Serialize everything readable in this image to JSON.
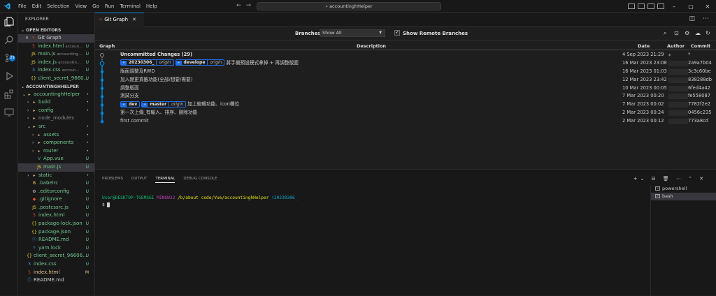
{
  "menu": [
    "File",
    "Edit",
    "Selection",
    "View",
    "Go",
    "Run",
    "Terminal",
    "Help"
  ],
  "search": {
    "text": "accountinghHelper"
  },
  "explorer": {
    "title": "EXPLORER",
    "open_editors": "OPEN EDITORS",
    "open_items": [
      {
        "name": "Git Graph",
        "sub": "",
        "status": "",
        "icon": "git-graph-icon",
        "color": "#cccccc"
      },
      {
        "name": "index.html",
        "sub": "accoun...",
        "status": "U",
        "icon": "html-icon",
        "color": "#73c991"
      },
      {
        "name": "main.js",
        "sub": "accounting...",
        "status": "U",
        "icon": "js-icon",
        "color": "#73c991"
      },
      {
        "name": "index.js",
        "sub": "accountin...",
        "status": "U",
        "icon": "js-icon",
        "color": "#73c991"
      },
      {
        "name": "index.css",
        "sub": "accoun...",
        "status": "U",
        "icon": "css-icon",
        "color": "#73c991"
      },
      {
        "name": "client_secret_9660...",
        "sub": "",
        "status": "U",
        "icon": "json-icon",
        "color": "#73c991"
      }
    ],
    "project": "ACCOUNTINGHHELPER",
    "tree": [
      {
        "name": "accountinghHelper",
        "indent": 0,
        "chev": "⌄",
        "status": "•",
        "icon": "folder-icon",
        "color": "#73c991"
      },
      {
        "name": "build",
        "indent": 1,
        "chev": "›",
        "status": "•",
        "icon": "folder-icon",
        "color": "#73c991"
      },
      {
        "name": "config",
        "indent": 1,
        "chev": "›",
        "status": "•",
        "icon": "folder-icon",
        "color": "#73c991"
      },
      {
        "name": "node_modules",
        "indent": 1,
        "chev": "›",
        "status": "",
        "icon": "folder-icon",
        "color": "#8c8c8c"
      },
      {
        "name": "src",
        "indent": 1,
        "chev": "⌄",
        "status": "•",
        "icon": "folder-icon",
        "color": "#73c991"
      },
      {
        "name": "assets",
        "indent": 2,
        "chev": "›",
        "status": "•",
        "icon": "folder-icon",
        "color": "#73c991"
      },
      {
        "name": "components",
        "indent": 2,
        "chev": "›",
        "status": "•",
        "icon": "folder-icon",
        "color": "#73c991"
      },
      {
        "name": "router",
        "indent": 2,
        "chev": "›",
        "status": "•",
        "icon": "folder-icon",
        "color": "#73c991"
      },
      {
        "name": "App.vue",
        "indent": 2,
        "chev": "",
        "status": "U",
        "icon": "vue-icon",
        "color": "#73c991"
      },
      {
        "name": "main.js",
        "indent": 2,
        "chev": "",
        "status": "U",
        "icon": "js-icon",
        "color": "#73c991",
        "selected": true
      },
      {
        "name": "static",
        "indent": 1,
        "chev": "›",
        "status": "•",
        "icon": "folder-icon",
        "color": "#73c991"
      },
      {
        "name": ".babelrc",
        "indent": 1,
        "chev": "",
        "status": "U",
        "icon": "babel-icon",
        "color": "#73c991"
      },
      {
        "name": ".editorconfig",
        "indent": 1,
        "chev": "",
        "status": "U",
        "icon": "gear-icon",
        "color": "#73c991"
      },
      {
        "name": ".gitignore",
        "indent": 1,
        "chev": "",
        "status": "U",
        "icon": "git-icon",
        "color": "#73c991"
      },
      {
        "name": ".postcssrc.js",
        "indent": 1,
        "chev": "",
        "status": "U",
        "icon": "js-icon",
        "color": "#73c991"
      },
      {
        "name": "index.html",
        "indent": 1,
        "chev": "",
        "status": "U",
        "icon": "html-icon",
        "color": "#73c991"
      },
      {
        "name": "package-lock.json",
        "indent": 1,
        "chev": "",
        "status": "U",
        "icon": "json-icon",
        "color": "#73c991"
      },
      {
        "name": "package.json",
        "indent": 1,
        "chev": "",
        "status": "U",
        "icon": "json-icon",
        "color": "#73c991"
      },
      {
        "name": "README.md",
        "indent": 1,
        "chev": "",
        "status": "U",
        "icon": "info-icon",
        "color": "#73c991"
      },
      {
        "name": "yarn.lock",
        "indent": 1,
        "chev": "",
        "status": "U",
        "icon": "yarn-icon",
        "color": "#73c991"
      },
      {
        "name": "client_secret_96606...",
        "indent": 0,
        "chev": "",
        "status": "U",
        "icon": "json-icon",
        "color": "#73c991"
      },
      {
        "name": "index.css",
        "indent": 0,
        "chev": "",
        "status": "U",
        "icon": "css-icon",
        "color": "#73c991"
      },
      {
        "name": "index.html",
        "indent": 0,
        "chev": "",
        "status": "M",
        "icon": "html-icon",
        "color": "#e2c08d"
      },
      {
        "name": "README.md",
        "indent": 0,
        "chev": "",
        "status": "",
        "icon": "info-icon",
        "color": "#cccccc"
      }
    ]
  },
  "tab": {
    "label": "Git Graph"
  },
  "gitgraph": {
    "branches_label": "Branches:",
    "branches_value": "Show All",
    "show_remote_label": "Show Remote Branches",
    "columns": {
      "graph": "Graph",
      "description": "Description",
      "date": "Date",
      "author": "Author",
      "commit": "Commit"
    },
    "commits": [
      {
        "desc": "Uncommitted Changes (29)",
        "refs": [],
        "date": "4 Sep 2023 21:29",
        "author": "*",
        "hash": "*"
      },
      {
        "desc": "將手機預設模式拿掉 + 再調整版面",
        "refs": [
          {
            "name": "20230306_",
            "origin": "origin"
          },
          {
            "name": "develope",
            "origin": "origin"
          }
        ],
        "date": "16 Mar 2023 23:08",
        "author": "",
        "hash": "2a9a7b04"
      },
      {
        "desc": "版面調整及RWD",
        "refs": [],
        "date": "16 Mar 2023 01:03",
        "author": "",
        "hash": "3c3c60be"
      },
      {
        "desc": "加入變更貨籤功能(全部/想要/需要)",
        "refs": [],
        "date": "12 Mar 2023 23:42",
        "author": "",
        "hash": "838288db"
      },
      {
        "desc": "調整版面",
        "refs": [],
        "date": "10 Mar 2023 00:05",
        "author": "",
        "hash": "6fed4a42"
      },
      {
        "desc": "測試分支",
        "refs": [],
        "date": "7 Mar 2023 00:20",
        "author": "",
        "hash": "fe558087"
      },
      {
        "desc": "加上編輯功能、icon欄位",
        "refs": [
          {
            "name": "dev",
            "origin": ""
          },
          {
            "name": "master",
            "origin": "origin"
          }
        ],
        "date": "7 Mar 2023 00:02",
        "author": "",
        "hash": "7782f2e2"
      },
      {
        "desc": "第一次上傳_有輸入、排序、刪除功能",
        "refs": [],
        "date": "2 Mar 2023 00:24",
        "author": "",
        "hash": "0456c235"
      },
      {
        "desc": "first commit",
        "refs": [],
        "date": "2 Mar 2023 00:12",
        "author": "",
        "hash": "773a8cd"
      }
    ]
  },
  "panel": {
    "tabs": [
      "PROBLEMS",
      "OUTPUT",
      "TERMINAL",
      "DEBUG CONSOLE"
    ],
    "active_tab": "TERMINAL",
    "prompt_user": "User@DESKTOP-TGEMSGI",
    "prompt_env": "MINGW32",
    "prompt_path": "/b/about code/Vue/accountinghHelper",
    "prompt_branch": "(20230306_",
    "prompt_line2": "$",
    "terminals": [
      "powershell",
      "bash"
    ]
  },
  "colors": {
    "accent": "#0078d4",
    "graph_blue": "#0085d9",
    "untracked": "#73c991",
    "modified": "#e2c08d"
  }
}
